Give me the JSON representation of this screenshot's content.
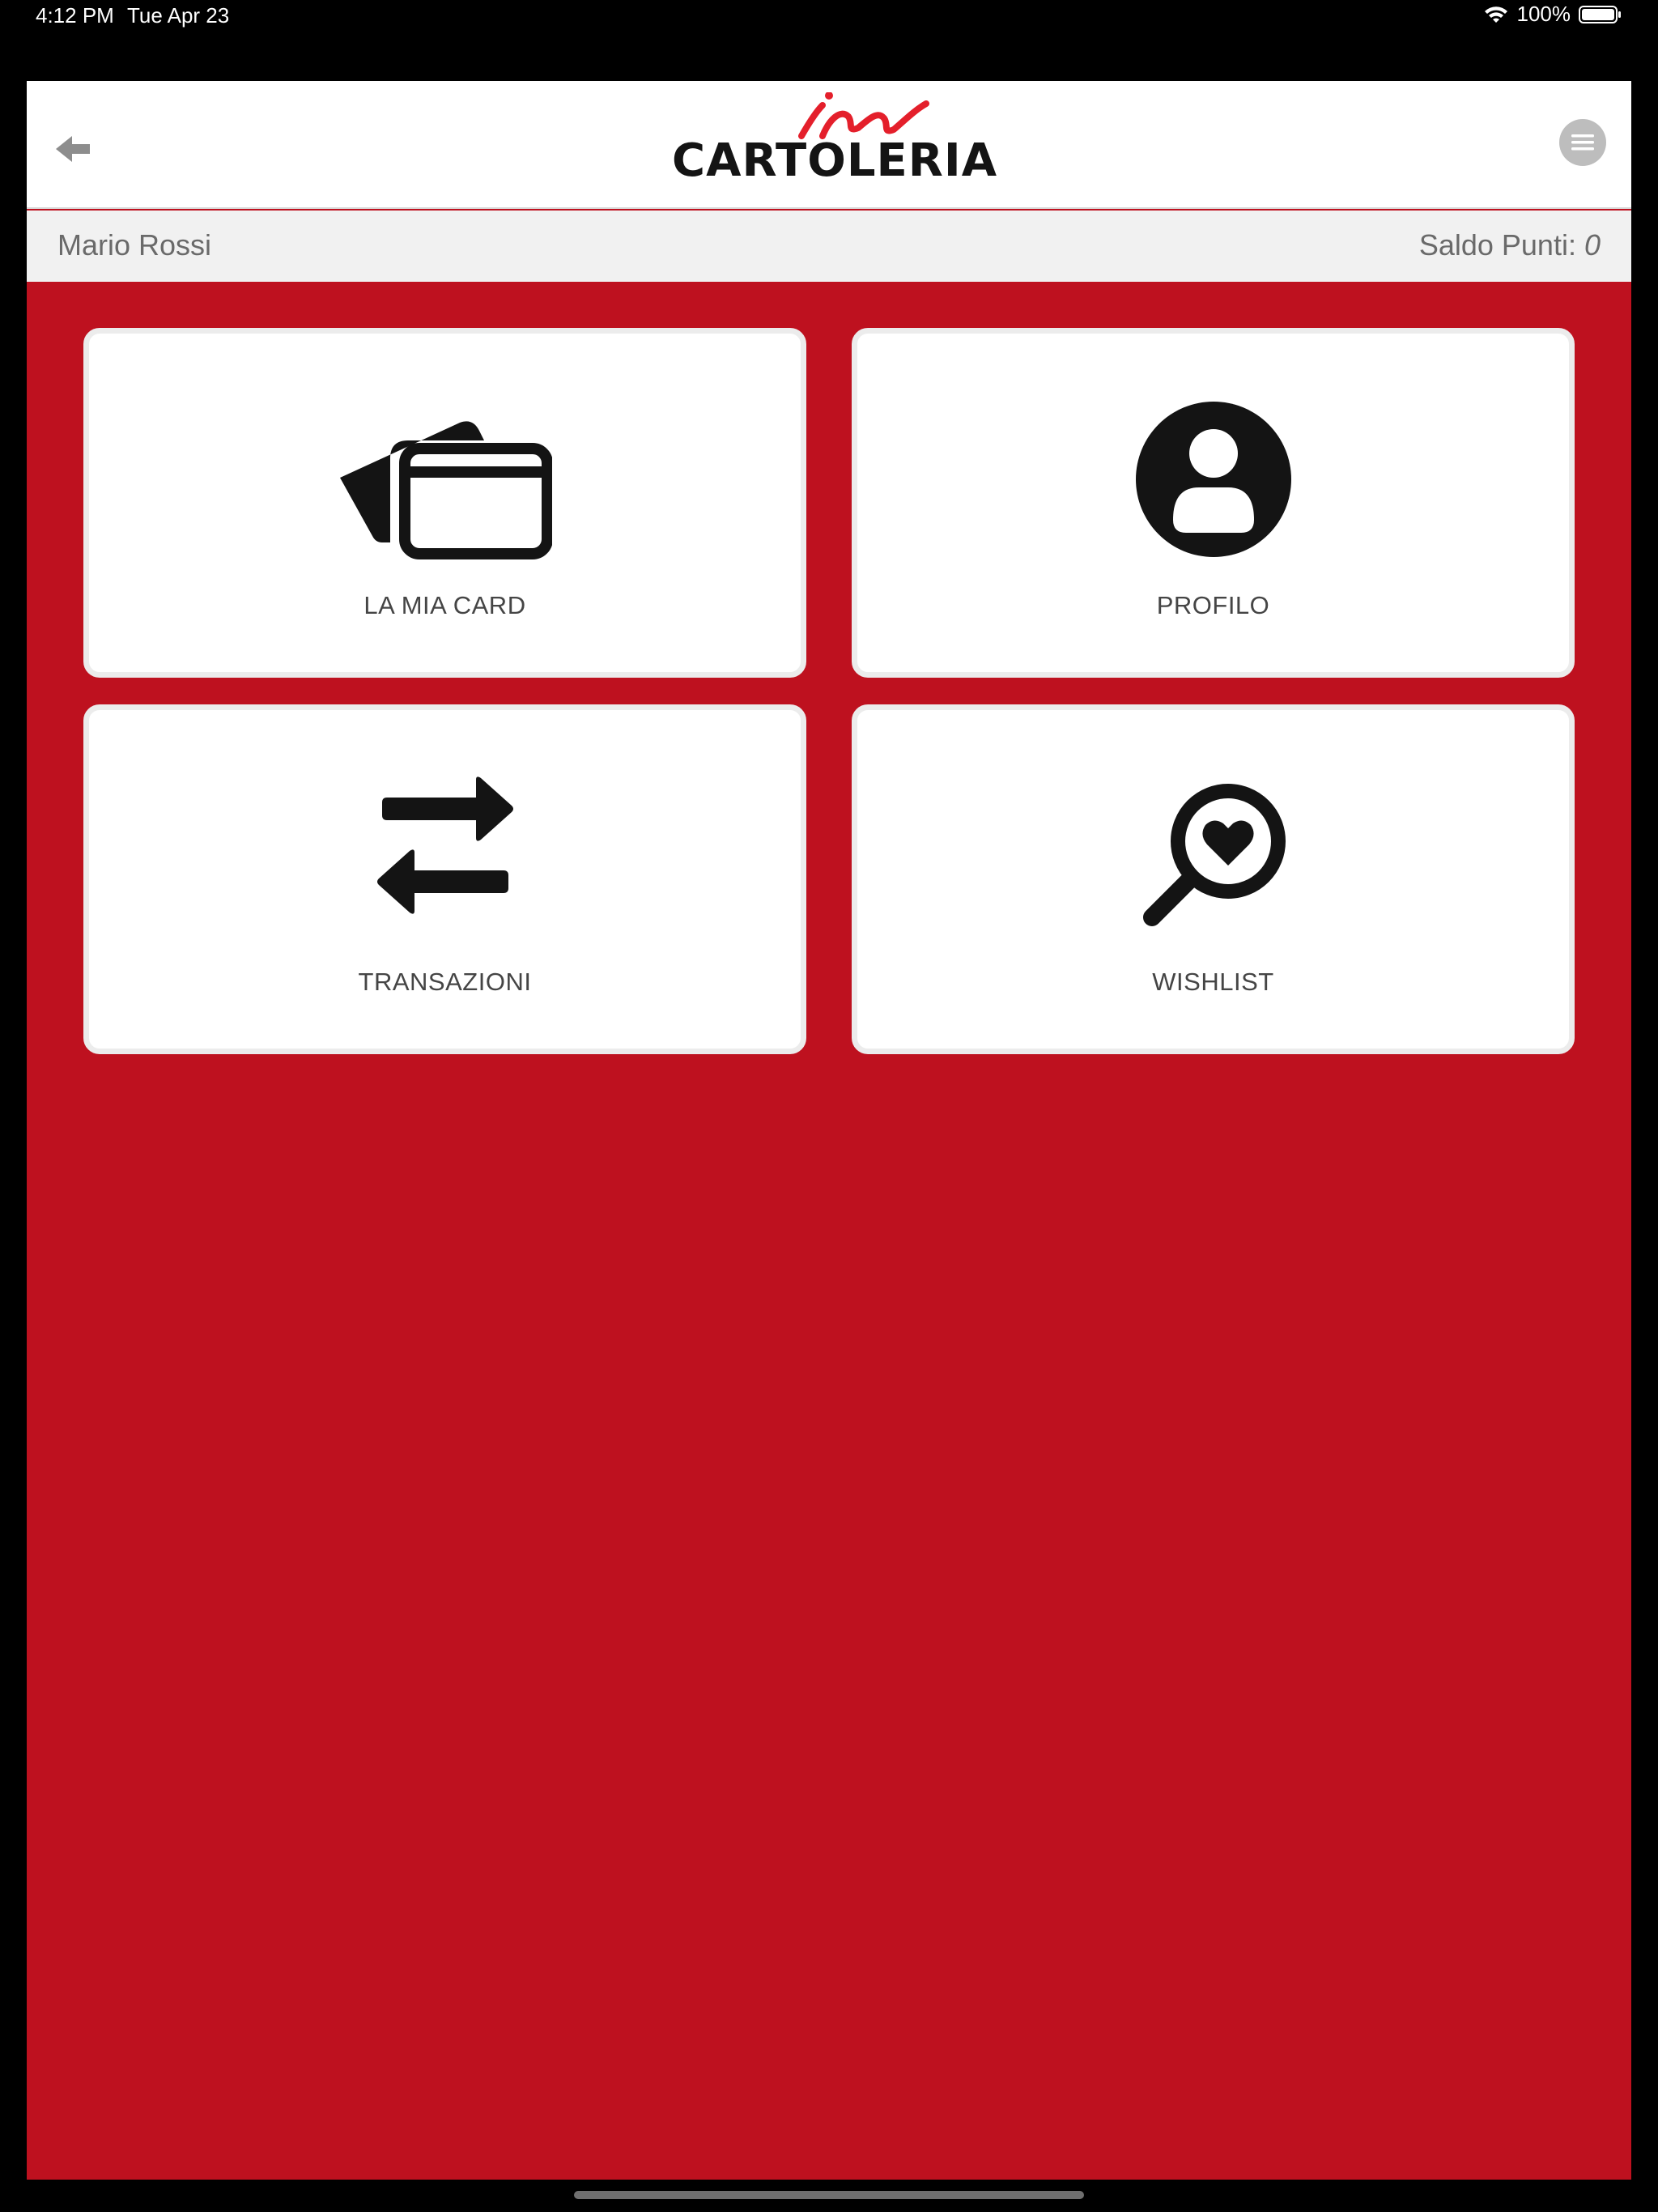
{
  "status_bar": {
    "time": "4:12 PM",
    "date": "Tue Apr 23",
    "battery": "100%",
    "icons": [
      "wifi-icon",
      "battery-icon"
    ]
  },
  "header": {
    "logo_script": "in",
    "logo_text": "CARTOLERIA",
    "back_icon": "arrow-left-icon",
    "menu_icon": "hamburger-menu-icon"
  },
  "user": {
    "name": "Mario Rossi",
    "points_label": "Saldo Punti:",
    "points_value": "0"
  },
  "tiles": [
    {
      "label": "LA MIA CARD",
      "icon": "credit-cards-icon"
    },
    {
      "label": "PROFILO",
      "icon": "user-circle-icon"
    },
    {
      "label": "TRANSAZIONI",
      "icon": "exchange-arrows-icon"
    },
    {
      "label": "WISHLIST",
      "icon": "search-heart-icon"
    }
  ],
  "colors": {
    "brand_red": "#be111f",
    "logo_red": "#e41f2b",
    "icon_dark": "#141414"
  }
}
